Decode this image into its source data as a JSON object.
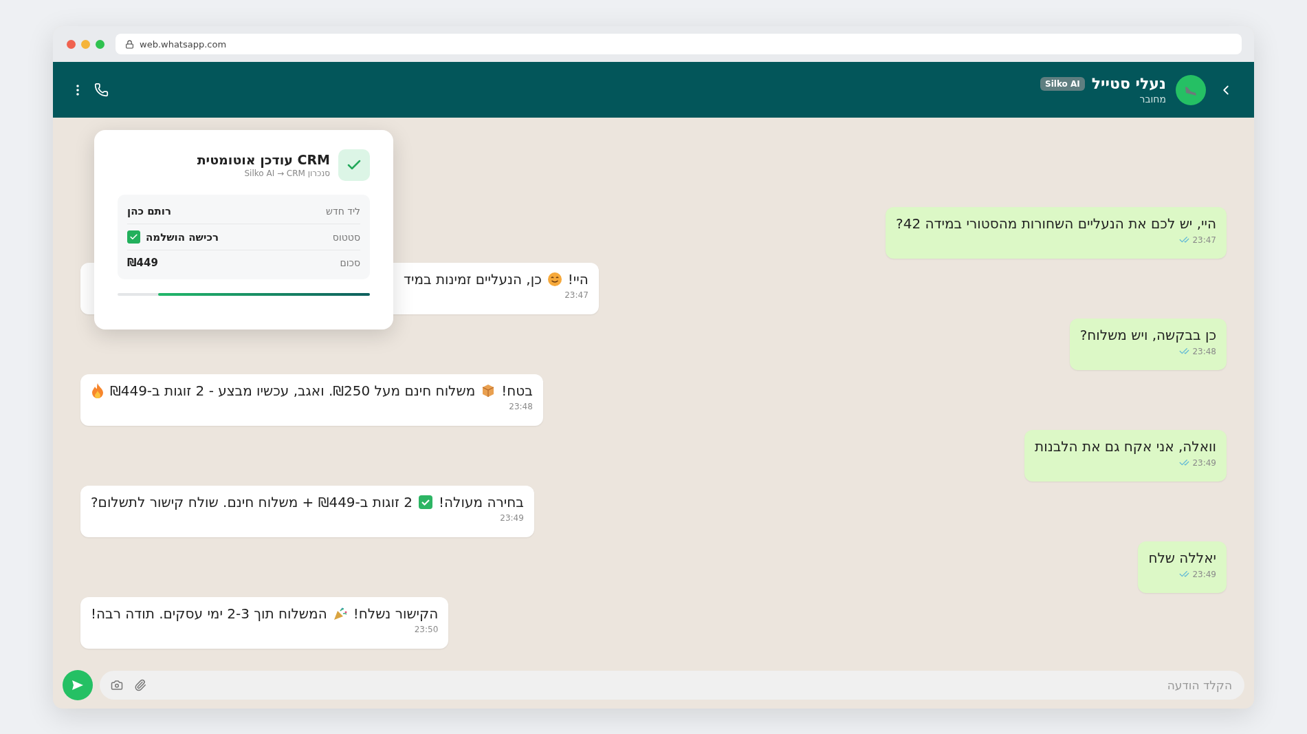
{
  "browser": {
    "url": "web.whatsapp.com"
  },
  "chat_header": {
    "name": "נעלי סטייל",
    "badge": "Silko AI",
    "status": "מחובר"
  },
  "messages": [
    {
      "kind": "outgoing",
      "parts": [
        {
          "kind": "text",
          "text": "היי, יש לכם את הנעליים השחורות מהסטורי במידה 42?"
        }
      ],
      "time": "23:47"
    },
    {
      "kind": "incoming",
      "parts": [
        {
          "kind": "text",
          "text": "היי!"
        },
        {
          "kind": "smile"
        },
        {
          "kind": "text",
          "text": "כן, הנעליים זמינות במיד"
        }
      ],
      "time": "23:47",
      "crm_card": {
        "title": "CRM עודכן אוטומטית",
        "subtitle": "סנכרון Silko AI → CRM",
        "rows": [
          {
            "kind": "text",
            "label": "ליד חדש",
            "value": "רותם כהן"
          },
          {
            "kind": "checkbox",
            "label": "סטטוס",
            "value": "רכישה הושלמה",
            "checked": true
          },
          {
            "kind": "text",
            "label": "סכום",
            "value": "₪449"
          }
        ],
        "level": 0.84
      }
    },
    {
      "kind": "outgoing",
      "parts": [
        {
          "kind": "text",
          "text": "כן בבקשה, ויש משלוח?"
        }
      ],
      "time": "23:48"
    },
    {
      "kind": "incoming",
      "parts": [
        {
          "kind": "text",
          "text": "בטח!"
        },
        {
          "kind": "box"
        },
        {
          "kind": "text",
          "text": "משלוח חינם מעל ₪250. ואגב, עכשיו מבצע - 2 זוגות ב-₪449"
        },
        {
          "kind": "flame"
        }
      ],
      "time": "23:48"
    },
    {
      "kind": "outgoing",
      "parts": [
        {
          "kind": "text",
          "text": "וואלה, אני אקח גם את הלבנות"
        }
      ],
      "time": "23:49"
    },
    {
      "kind": "incoming",
      "parts": [
        {
          "kind": "text",
          "text": "בחירה מעולה!"
        },
        {
          "kind": "check"
        },
        {
          "kind": "text",
          "text": "2 זוגות ב-₪449 + משלוח חינם. שולח קישור לתשלום?"
        }
      ],
      "time": "23:49"
    },
    {
      "kind": "outgoing",
      "parts": [
        {
          "kind": "text",
          "text": "יאללה שלח"
        }
      ],
      "time": "23:49"
    },
    {
      "kind": "incoming",
      "parts": [
        {
          "kind": "text",
          "text": "הקישור נשלח!"
        },
        {
          "kind": "party"
        },
        {
          "kind": "text",
          "text": "המשלוח תוך 2-3 ימי עסקים. תודה רבה!"
        }
      ],
      "time": "23:50"
    }
  ],
  "composer": {
    "placeholder": "הקלד הודעה"
  }
}
